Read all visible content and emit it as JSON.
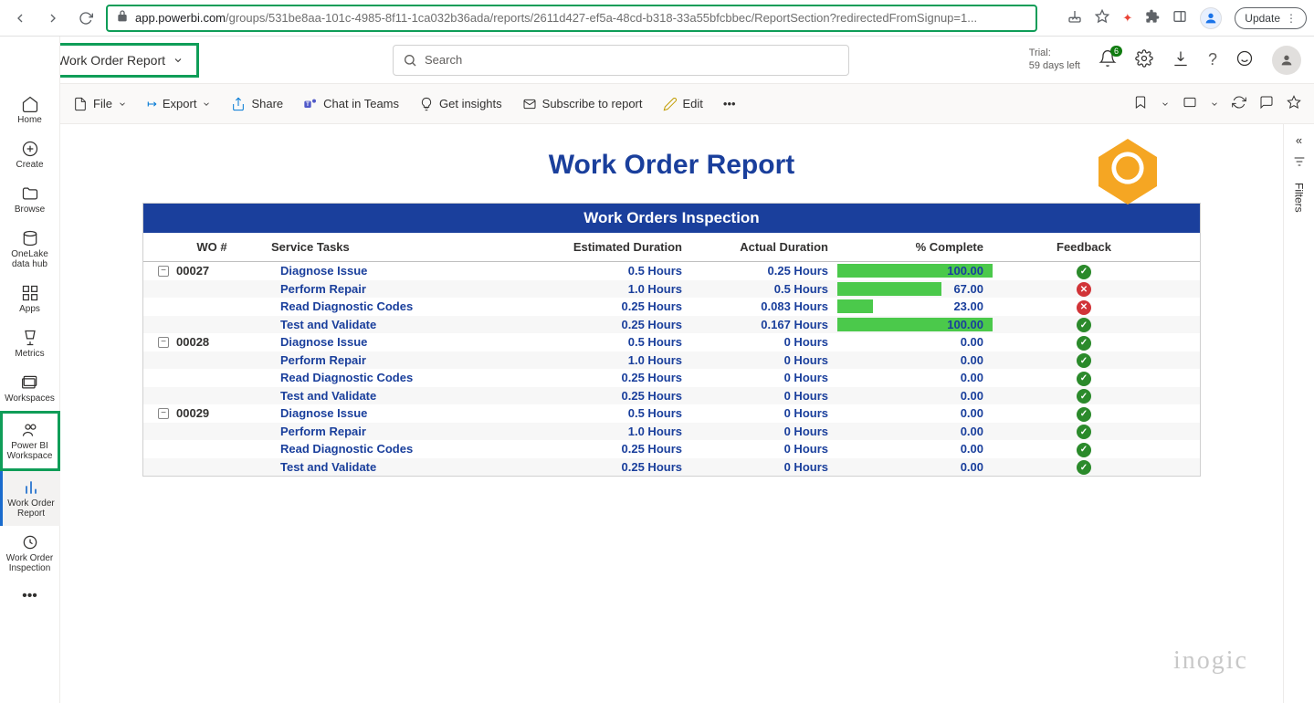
{
  "browser": {
    "url_visible": "app.powerbi.com",
    "url_rest": "/groups/531be8aa-101c-4985-8f11-1ca032b36ada/reports/2611d427-ef5a-48cd-b318-33a55bfcbbec/ReportSection?redirectedFromSignup=1...",
    "update_label": "Update"
  },
  "app": {
    "report_name": "Work Order Report",
    "search_placeholder": "Search",
    "trial_line1": "Trial:",
    "trial_line2": "59 days left",
    "notif_count": "6"
  },
  "toolbar": {
    "file": "File",
    "export": "Export",
    "share": "Share",
    "chat": "Chat in Teams",
    "insights": "Get insights",
    "subscribe": "Subscribe to report",
    "edit": "Edit"
  },
  "nav": {
    "home": "Home",
    "create": "Create",
    "browse": "Browse",
    "onelake": "OneLake data hub",
    "apps": "Apps",
    "metrics": "Metrics",
    "workspaces": "Workspaces",
    "pbiws": "Power BI Workspace",
    "wor": "Work Order Report",
    "woi": "Work Order Inspection"
  },
  "report": {
    "title": "Work Order Report",
    "banner": "Work Orders Inspection",
    "columns": {
      "wo": "WO #",
      "task": "Service Tasks",
      "est": "Estimated Duration",
      "act": "Actual Duration",
      "pct": "% Complete",
      "fb": "Feedback"
    },
    "watermark": "inogic"
  },
  "filters": {
    "label": "Filters"
  },
  "chart_data": {
    "type": "table",
    "columns": [
      "WO #",
      "Service Tasks",
      "Estimated Duration",
      "Actual Duration",
      "% Complete",
      "Feedback"
    ],
    "groups": [
      {
        "wo": "00027",
        "rows": [
          {
            "task": "Diagnose Issue",
            "est": "0.5 Hours",
            "act": "0.25 Hours",
            "pct": 100.0,
            "fb": "ok"
          },
          {
            "task": "Perform Repair",
            "est": "1.0 Hours",
            "act": "0.5 Hours",
            "pct": 67.0,
            "fb": "bad"
          },
          {
            "task": "Read Diagnostic Codes",
            "est": "0.25 Hours",
            "act": "0.083 Hours",
            "pct": 23.0,
            "fb": "bad"
          },
          {
            "task": "Test and Validate",
            "est": "0.25 Hours",
            "act": "0.167 Hours",
            "pct": 100.0,
            "fb": "ok"
          }
        ]
      },
      {
        "wo": "00028",
        "rows": [
          {
            "task": "Diagnose Issue",
            "est": "0.5 Hours",
            "act": "0 Hours",
            "pct": 0.0,
            "fb": "ok"
          },
          {
            "task": "Perform Repair",
            "est": "1.0 Hours",
            "act": "0 Hours",
            "pct": 0.0,
            "fb": "ok"
          },
          {
            "task": "Read Diagnostic Codes",
            "est": "0.25 Hours",
            "act": "0 Hours",
            "pct": 0.0,
            "fb": "ok"
          },
          {
            "task": "Test and Validate",
            "est": "0.25 Hours",
            "act": "0 Hours",
            "pct": 0.0,
            "fb": "ok"
          }
        ]
      },
      {
        "wo": "00029",
        "rows": [
          {
            "task": "Diagnose Issue",
            "est": "0.5 Hours",
            "act": "0 Hours",
            "pct": 0.0,
            "fb": "ok"
          },
          {
            "task": "Perform Repair",
            "est": "1.0 Hours",
            "act": "0 Hours",
            "pct": 0.0,
            "fb": "ok"
          },
          {
            "task": "Read Diagnostic Codes",
            "est": "0.25 Hours",
            "act": "0 Hours",
            "pct": 0.0,
            "fb": "ok"
          },
          {
            "task": "Test and Validate",
            "est": "0.25 Hours",
            "act": "0 Hours",
            "pct": 0.0,
            "fb": "ok"
          }
        ]
      }
    ]
  }
}
